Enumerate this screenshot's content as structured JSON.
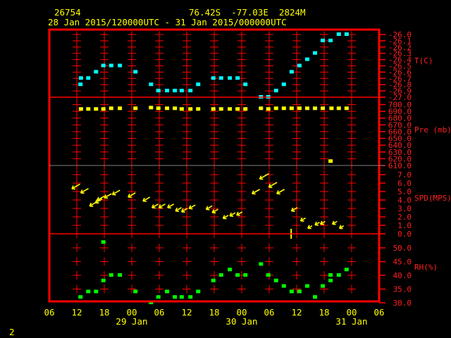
{
  "header": {
    "station_id": "26754",
    "location": "76.42S  -77.03E  2824M",
    "time_range": "28 Jan 2015/120000UTC - 31 Jan 2015/000000UTC"
  },
  "footer": {
    "page_number": "2"
  },
  "colors": {
    "frame": "#ff0000",
    "temperature": "#00ffff",
    "pressure": "#ffff00",
    "wind": "#ffff00",
    "rh": "#00ff00",
    "text": "#ffff00"
  },
  "chart_data": {
    "type": "scatter",
    "x_unit": "hours since 28 Jan 2015 06UTC",
    "xlim": [
      0,
      72
    ],
    "x_tick_labels": [
      "06",
      "12",
      "18",
      "00",
      "06",
      "12",
      "18",
      "00",
      "06",
      "12",
      "18",
      "00",
      "06"
    ],
    "date_labels": [
      "29 Jan",
      "30 Jan",
      "31 Jan"
    ],
    "panels": [
      {
        "name": "temperature",
        "label": "T(C)",
        "ylim": [
          -27.0,
          -26.0
        ],
        "tick_labels": [
          "-26.0",
          "-26.1",
          "-26.2",
          "-26.3",
          "-26.4",
          "-26.5",
          "-26.6",
          "-26.7",
          "-26.8",
          "-26.9",
          "-27.0"
        ],
        "points": [
          [
            6.8,
            -26.8
          ],
          [
            6.9,
            -26.7
          ],
          [
            8.5,
            -26.7
          ],
          [
            10.2,
            -26.6
          ],
          [
            11.8,
            -26.5
          ],
          [
            13.5,
            -26.5
          ],
          [
            15.4,
            -26.5
          ],
          [
            18.8,
            -26.6
          ],
          [
            22.2,
            -26.8
          ],
          [
            23.8,
            -26.9
          ],
          [
            25.7,
            -26.9
          ],
          [
            27.4,
            -26.9
          ],
          [
            28.9,
            -26.9
          ],
          [
            30.8,
            -26.9
          ],
          [
            32.5,
            -26.8
          ],
          [
            35.8,
            -26.7
          ],
          [
            37.5,
            -26.7
          ],
          [
            39.4,
            -26.7
          ],
          [
            41.1,
            -26.7
          ],
          [
            42.8,
            -26.8
          ],
          [
            46.2,
            -27.0
          ],
          [
            47.8,
            -27.0
          ],
          [
            49.5,
            -26.9
          ],
          [
            51.2,
            -26.8
          ],
          [
            52.9,
            -26.6
          ],
          [
            54.6,
            -26.5
          ],
          [
            56.3,
            -26.4
          ],
          [
            58.0,
            -26.3
          ],
          [
            59.7,
            -26.1
          ],
          [
            61.4,
            -26.1
          ],
          [
            63.2,
            -26.0
          ],
          [
            64.9,
            -26.0
          ]
        ]
      },
      {
        "name": "pressure",
        "label": "Pre (mb)",
        "ylim": [
          610,
          700
        ],
        "tick_labels": [
          "700.0",
          "690.0",
          "680.0",
          "670.0",
          "660.0",
          "650.0",
          "640.0",
          "630.0",
          "620.0",
          "610.0"
        ],
        "points": [
          [
            6.9,
            693
          ],
          [
            8.5,
            693
          ],
          [
            10.2,
            693
          ],
          [
            11.8,
            693
          ],
          [
            13.5,
            694
          ],
          [
            15.4,
            694
          ],
          [
            18.8,
            694
          ],
          [
            22.2,
            695
          ],
          [
            23.8,
            694
          ],
          [
            25.7,
            694
          ],
          [
            27.4,
            694
          ],
          [
            28.9,
            693
          ],
          [
            30.8,
            693
          ],
          [
            32.5,
            693
          ],
          [
            35.8,
            693
          ],
          [
            37.5,
            693
          ],
          [
            39.4,
            693
          ],
          [
            41.1,
            693
          ],
          [
            42.8,
            693
          ],
          [
            46.2,
            694
          ],
          [
            47.8,
            693
          ],
          [
            49.5,
            694
          ],
          [
            51.2,
            694
          ],
          [
            52.9,
            694
          ],
          [
            54.6,
            694
          ],
          [
            56.3,
            694
          ],
          [
            58.0,
            694
          ],
          [
            59.7,
            694
          ],
          [
            61.4,
            616
          ],
          [
            61.6,
            694
          ],
          [
            63.2,
            694
          ],
          [
            64.9,
            694
          ]
        ]
      },
      {
        "name": "wind_speed",
        "label": "SPD(MPS)",
        "ylim": [
          0,
          7
        ],
        "tick_labels": [
          "7.0",
          "6.0",
          "5.0",
          "4.0",
          "3.0",
          "2.0",
          "1.0",
          "0.0"
        ],
        "direction_from_deg": 60,
        "points": [
          [
            5.8,
            5.6
          ],
          [
            7.7,
            5.1
          ],
          [
            9.5,
            3.5
          ],
          [
            10.8,
            3.9
          ],
          [
            11.2,
            4.2
          ],
          [
            12.8,
            4.5
          ],
          [
            14.6,
            4.9
          ],
          [
            18.0,
            4.6
          ],
          [
            21.2,
            4.1
          ],
          [
            23.1,
            3.3
          ],
          [
            24.6,
            3.3
          ],
          [
            26.5,
            3.3
          ],
          [
            28.2,
            2.9
          ],
          [
            29.5,
            2.8
          ],
          [
            31.2,
            3.2
          ],
          [
            34.9,
            3.1
          ],
          [
            36.2,
            2.7
          ],
          [
            38.5,
            2.0
          ],
          [
            40.0,
            2.3
          ],
          [
            41.5,
            2.4
          ],
          [
            45.1,
            5.0
          ],
          [
            46.9,
            6.8
          ],
          [
            48.8,
            5.8
          ],
          [
            50.5,
            5.0
          ],
          [
            53.5,
            2.9
          ],
          [
            55.4,
            1.7
          ],
          [
            56.9,
            0.8
          ],
          [
            58.5,
            1.2
          ],
          [
            59.7,
            1.3
          ],
          [
            62.3,
            1.3
          ],
          [
            63.8,
            0.8
          ]
        ],
        "calm_marks": [
          52.8
        ]
      },
      {
        "name": "relative_humidity",
        "label": "RH(%)",
        "ylim": [
          30,
          50
        ],
        "tick_labels": [
          "50.0",
          "45.0",
          "40.0",
          "35.0",
          "30.0"
        ],
        "points": [
          [
            6.8,
            32
          ],
          [
            8.5,
            34
          ],
          [
            10.2,
            34
          ],
          [
            11.8,
            52
          ],
          [
            11.8,
            38
          ],
          [
            13.5,
            40
          ],
          [
            15.4,
            40
          ],
          [
            18.8,
            34
          ],
          [
            22.2,
            30
          ],
          [
            23.8,
            32
          ],
          [
            25.7,
            34
          ],
          [
            27.4,
            32
          ],
          [
            28.9,
            32
          ],
          [
            30.8,
            32
          ],
          [
            32.5,
            34
          ],
          [
            35.8,
            38
          ],
          [
            37.5,
            40
          ],
          [
            39.4,
            42
          ],
          [
            41.1,
            40
          ],
          [
            42.8,
            40
          ],
          [
            46.2,
            44
          ],
          [
            47.8,
            40
          ],
          [
            49.5,
            38
          ],
          [
            51.2,
            36
          ],
          [
            52.9,
            34
          ],
          [
            54.6,
            34
          ],
          [
            56.3,
            36
          ],
          [
            58.0,
            32
          ],
          [
            59.7,
            36
          ],
          [
            61.4,
            38
          ],
          [
            61.4,
            40
          ],
          [
            63.2,
            40
          ],
          [
            64.9,
            42
          ]
        ]
      }
    ]
  }
}
